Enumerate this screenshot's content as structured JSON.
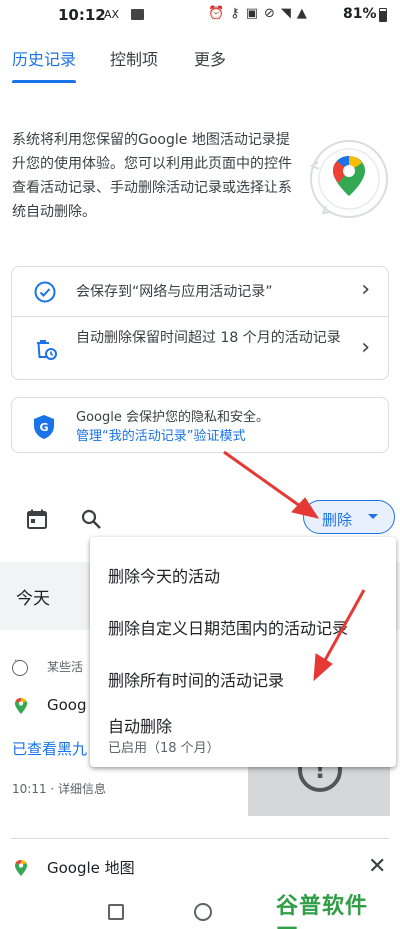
{
  "status_bar": {
    "time": "10:12",
    "indicator": "AX",
    "icons": [
      "alarm-icon",
      "key-icon",
      "nfc-icon",
      "mute-icon",
      "wifi-icon",
      "signal-4g-icon"
    ],
    "battery": "81%"
  },
  "tabs": [
    {
      "label": "历史记录",
      "active": true
    },
    {
      "label": "控制项",
      "active": false
    },
    {
      "label": "更多",
      "active": false
    }
  ],
  "intro": {
    "text": "系统将利用您保留的Google 地图活动记录提升您的使用体验。您可以利用此页面中的控件查看活动记录、手动删除活动记录或选择让系统自动删除。"
  },
  "settings": {
    "save_to": "会保存到“网络与应用活动记录”",
    "auto_delete": "自动删除保留时间超过 18 个月的活动记录"
  },
  "privacy": {
    "text": "Google 会保护您的隐私和安全。",
    "link": "管理“我的活动记录”验证模式"
  },
  "toolbar": {
    "delete_label": "删除"
  },
  "list": {
    "section": "今天",
    "meta": "某些活",
    "app": "Goog",
    "viewed": "已查看黑九",
    "time": "10:11 · 详细信息",
    "app_2": "Google 地图"
  },
  "menu": {
    "items": [
      "删除今天的活动",
      "删除自定义日期范围内的活动记录",
      "删除所有时间的活动记录",
      "自动删除"
    ],
    "auto_delete_sub": "已启用（18 个月）"
  },
  "watermark": "谷普软件园",
  "colors": {
    "accent": "#1a73e8",
    "annotation": "#e53935",
    "watermark": "#2f9e46"
  }
}
